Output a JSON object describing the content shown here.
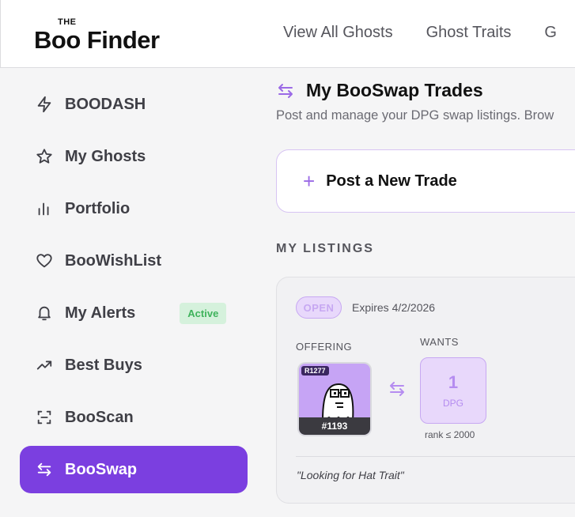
{
  "header": {
    "logo_the": "THE",
    "logo_text": "Boo Finder",
    "nav": [
      "View All Ghosts",
      "Ghost Traits",
      "G"
    ]
  },
  "sidebar": {
    "items": [
      {
        "label": "BOODASH",
        "icon": "lightning-icon"
      },
      {
        "label": "My Ghosts",
        "icon": "star-icon"
      },
      {
        "label": "Portfolio",
        "icon": "bar-chart-icon"
      },
      {
        "label": "BooWishList",
        "icon": "heart-icon"
      },
      {
        "label": "My Alerts",
        "icon": "bell-icon",
        "badge": "Active"
      },
      {
        "label": "Best Buys",
        "icon": "trending-up-icon"
      },
      {
        "label": "BooScan",
        "icon": "scan-icon"
      },
      {
        "label": "BooSwap",
        "icon": "swap-icon",
        "active": true
      }
    ]
  },
  "main": {
    "title": "My BooSwap Trades",
    "subtitle": "Post and manage your DPG swap listings. Brow",
    "post_button": "Post a New Trade",
    "section_label": "MY LISTINGS",
    "listing": {
      "status": "OPEN",
      "expires": "Expires 4/2/2026",
      "offering_label": "OFFERING",
      "wants_label": "WANTS",
      "nft_rank": "R1277",
      "nft_id": "#1193",
      "wants_count": "1",
      "wants_unit": "DPG",
      "rank_note": "rank ≤ 2000",
      "note": "\"Looking for Hat Trait\""
    }
  },
  "colors": {
    "accent": "#7b3fe0",
    "accent_light": "#e8d8fb",
    "badge_green": "#3fb35c"
  }
}
